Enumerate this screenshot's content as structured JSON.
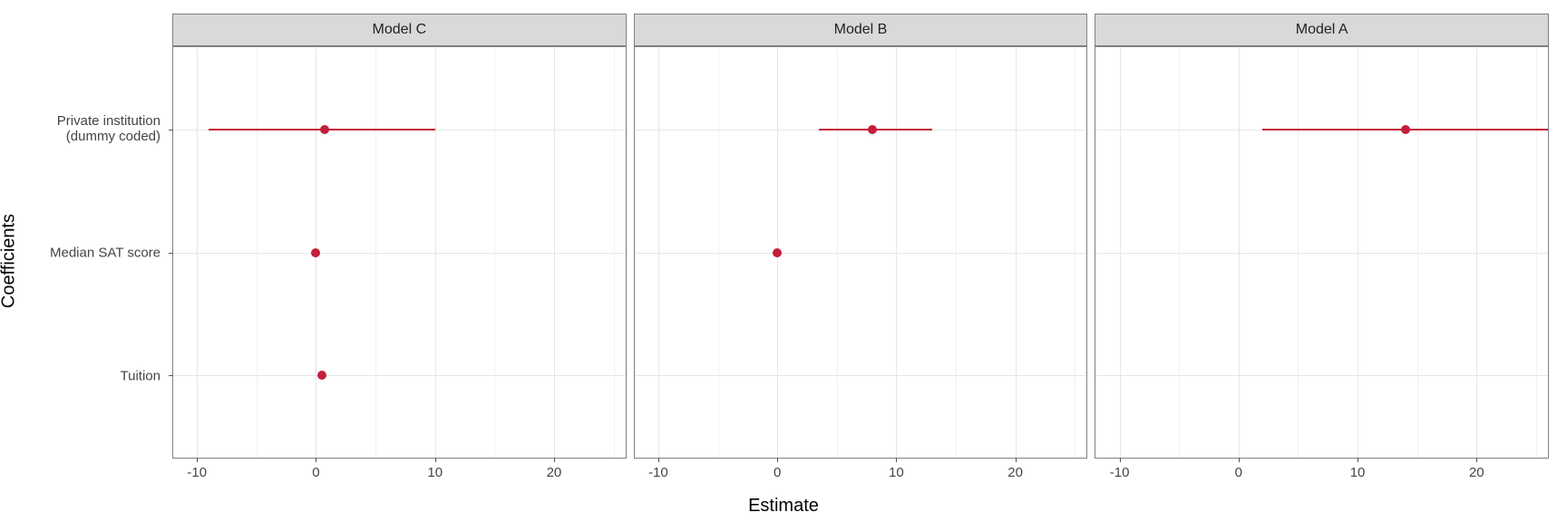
{
  "chart_data": {
    "type": "scatter",
    "title": "",
    "xlabel": "Estimate",
    "ylabel": "Coefficients",
    "xlim": [
      -12,
      26
    ],
    "yCategories": [
      "Private institution\n(dummy coded)",
      "Median SAT score",
      "Tuition"
    ],
    "xTicks": [
      -10,
      0,
      10,
      20
    ],
    "panels": [
      {
        "name": "Model C",
        "points": [
          {
            "y": "Private institution",
            "estimate": 0.7,
            "low": -9.0,
            "high": 10.0
          },
          {
            "y": "Median SAT score",
            "estimate": 0.0,
            "low": 0.0,
            "high": 0.0
          },
          {
            "y": "Tuition",
            "estimate": 0.5,
            "low": 0.5,
            "high": 0.5
          }
        ]
      },
      {
        "name": "Model B",
        "points": [
          {
            "y": "Private institution",
            "estimate": 8.0,
            "low": 3.5,
            "high": 13.0
          },
          {
            "y": "Median SAT score",
            "estimate": 0.0,
            "low": 0.0,
            "high": 0.0
          }
        ]
      },
      {
        "name": "Model A",
        "points": [
          {
            "y": "Private institution",
            "estimate": 14.0,
            "low": 2.0,
            "high": 26.0
          }
        ]
      }
    ],
    "color": "#c41e3a"
  }
}
